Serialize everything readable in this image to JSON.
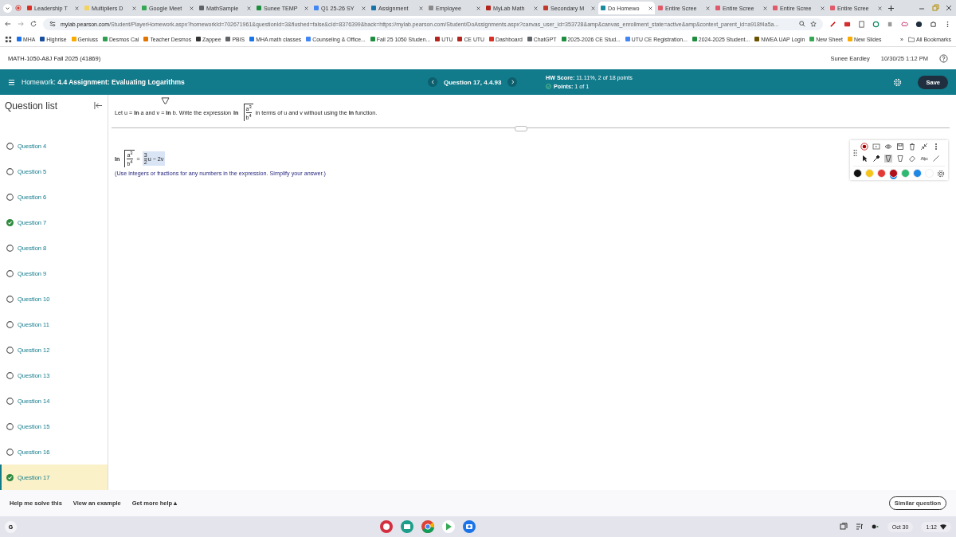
{
  "browser": {
    "tabs": [
      {
        "title": "Leadership T",
        "color": "#d93025",
        "selected": false
      },
      {
        "title": "Multipliers D",
        "color": "#f4d35e",
        "selected": false
      },
      {
        "title": "Google Meet",
        "color": "#34a853",
        "selected": false
      },
      {
        "title": "MathSample",
        "color": "#5f6368",
        "selected": false
      },
      {
        "title": "Sunee TEMP",
        "color": "#1e8e3e",
        "selected": false
      },
      {
        "title": "Q1 25-26 SY",
        "color": "#4285f4",
        "selected": false
      },
      {
        "title": "Assignment",
        "color": "#1a73a8",
        "selected": false
      },
      {
        "title": "Employee",
        "color": "#8a8a8a",
        "selected": false
      },
      {
        "title": "MyLab Math",
        "color": "#b3261e",
        "selected": false
      },
      {
        "title": "Secondary M",
        "color": "#c0392b",
        "selected": false
      },
      {
        "title": "Do Homewo",
        "color": "#1a8aa0",
        "selected": true
      },
      {
        "title": "Entire Scree",
        "color": "#e05a6a",
        "selected": false
      },
      {
        "title": "Entire Scree",
        "color": "#e05a6a",
        "selected": false
      },
      {
        "title": "Entire Scree",
        "color": "#e05a6a",
        "selected": false
      },
      {
        "title": "Entire Scree",
        "color": "#e05a6a",
        "selected": false
      }
    ],
    "url_host": "mylab.pearson.com",
    "url_path": "/Student/PlayerHomework.aspx?homeworkId=702671961&questionId=3&flushed=false&cId=8376399&back=https://mylab.pearson.com/Student/DoAssignments.aspx?canvas_user_id=353728&amp&canvas_enrollment_state=active&amp&context_parent_id=a918f4a5a...",
    "bookmarks": [
      {
        "label": "MHA",
        "color": "#1a73e8"
      },
      {
        "label": "Highrise",
        "color": "#1a4f9c"
      },
      {
        "label": "Geniuss",
        "color": "#f9ab00"
      },
      {
        "label": "Desmos Cal",
        "color": "#2e9e4f"
      },
      {
        "label": "Teacher Desmos",
        "color": "#e37400"
      },
      {
        "label": "Zappee",
        "color": "#333333"
      },
      {
        "label": "PBIS",
        "color": "#5f6368"
      },
      {
        "label": "MHA math classes",
        "color": "#1a73e8"
      },
      {
        "label": "Counseling & Office...",
        "color": "#4285f4"
      },
      {
        "label": "Fall 25 1050 Studen...",
        "color": "#1e8e3e"
      },
      {
        "label": "UTU",
        "color": "#b3261e"
      },
      {
        "label": "CE UTU",
        "color": "#b3261e"
      },
      {
        "label": "Dashboard",
        "color": "#d93025"
      },
      {
        "label": "ChatGPT",
        "color": "#5f6368"
      },
      {
        "label": "2025-2026 CE Stud...",
        "color": "#1e8e3e"
      },
      {
        "label": "UTU CE Registration...",
        "color": "#4285f4"
      },
      {
        "label": "2024-2025 Student...",
        "color": "#1e8e3e"
      },
      {
        "label": "NWEA UAP Login",
        "color": "#6b5200"
      },
      {
        "label": "New Sheet",
        "color": "#34a853"
      },
      {
        "label": "New Slides",
        "color": "#f9ab00"
      }
    ],
    "more": "»",
    "all_bookmarks": "All Bookmarks"
  },
  "header": {
    "course": "MATH-1050-A8J Fall 2025 (41869)",
    "user": "Sunee Eardley",
    "datetime": "10/30/25 1:12 PM"
  },
  "assignment_bar": {
    "title": "Homework: **4.4 Assignment: Evaluating Logarithms**",
    "question": "Question 17, 4.4.93",
    "score": "**HW Score:** 11.11%, 2 of 18 points",
    "points": "**Points:** 1 of 1",
    "save": "Save"
  },
  "sidebar": {
    "title": "Question list",
    "questions": [
      {
        "label": "Question 4",
        "completed": false,
        "selected": false
      },
      {
        "label": "Question 5",
        "completed": false,
        "selected": false
      },
      {
        "label": "Question 6",
        "completed": false,
        "selected": false
      },
      {
        "label": "Question 7",
        "completed": true,
        "selected": false
      },
      {
        "label": "Question 8",
        "completed": false,
        "selected": false
      },
      {
        "label": "Question 9",
        "completed": false,
        "selected": false
      },
      {
        "label": "Question 10",
        "completed": false,
        "selected": false
      },
      {
        "label": "Question 11",
        "completed": false,
        "selected": false
      },
      {
        "label": "Question 12",
        "completed": false,
        "selected": false
      },
      {
        "label": "Question 13",
        "completed": false,
        "selected": false
      },
      {
        "label": "Question 14",
        "completed": false,
        "selected": false
      },
      {
        "label": "Question 15",
        "completed": false,
        "selected": false
      },
      {
        "label": "Question 16",
        "completed": false,
        "selected": false
      },
      {
        "label": "Question 17",
        "completed": true,
        "selected": true
      }
    ]
  },
  "question": {
    "prompt_start": "Let u = **ln** a and v = **ln** b.  Write the expression",
    "ln": "ln",
    "numerator": "a$^{3}$",
    "denominator": "b$^{4}$",
    "prompt_end": "in terms of u and v without using the **ln** function.",
    "answer_ln": "ln",
    "answer_numerator": "a$^{3}$",
    "answer_denominator": "b$^{4}$",
    "equals": "=",
    "answer_coef_num": "3",
    "answer_coef_den": "2",
    "answer_rest": "u − 2v",
    "hint": "(Use integers or fractions for any numbers in the expression.  Simplify your answer.)"
  },
  "annotation_toolbar": {
    "colors": [
      {
        "color": "#111111",
        "selected": false
      },
      {
        "color": "#f5c518",
        "selected": false
      },
      {
        "color": "#e53935",
        "selected": false
      },
      {
        "color": "#b0101c",
        "selected": true
      },
      {
        "color": "#2eb872",
        "selected": false
      },
      {
        "color": "#1e88e5",
        "selected": false
      },
      {
        "color": "#ffffff",
        "selected": false
      }
    ]
  },
  "help": {
    "buttons": [
      "Help me solve this",
      "View an example"
    ],
    "more": "Get more help ▴",
    "similar": "Similar question"
  },
  "taskbar": {
    "launcher": "G",
    "date": "Oct 30",
    "time": "1:12"
  }
}
